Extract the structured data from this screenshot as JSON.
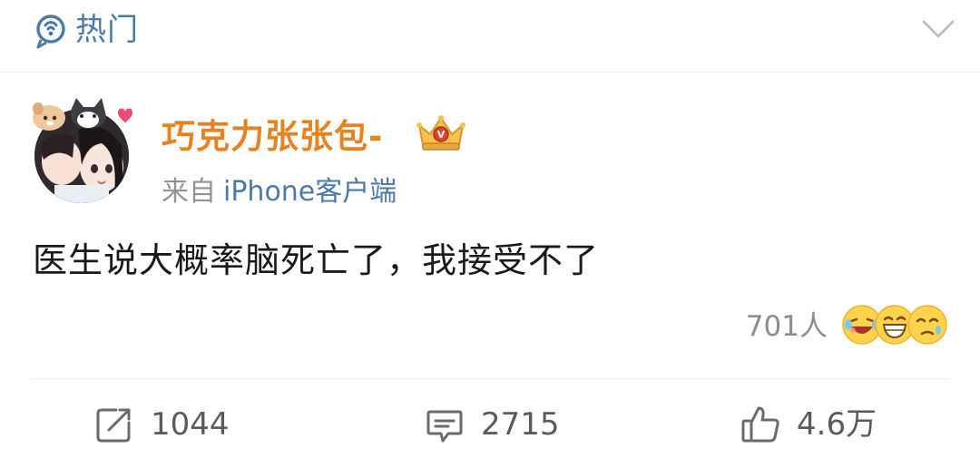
{
  "topbar": {
    "title": "热门",
    "icon": "hot-pin-icon",
    "collapse_icon": "chevron-down-icon"
  },
  "post": {
    "username": "巧克力张张包-",
    "badge_icon": "crown-vip-icon",
    "source_prefix": "来自",
    "source_client": "iPhone客户端",
    "text": "医生说大概率脑死亡了，我接受不了",
    "reactions": {
      "count_label": "701人",
      "emojis": [
        "laugh-cry-emoji",
        "grin-emoji",
        "sad-emoji"
      ]
    }
  },
  "actions": {
    "repost_count": "1044",
    "comment_count": "2715",
    "like_count": "4.6万"
  },
  "colors": {
    "link_blue": "#4b79a9",
    "username_orange": "#e8821e",
    "muted_gray": "#939393"
  }
}
